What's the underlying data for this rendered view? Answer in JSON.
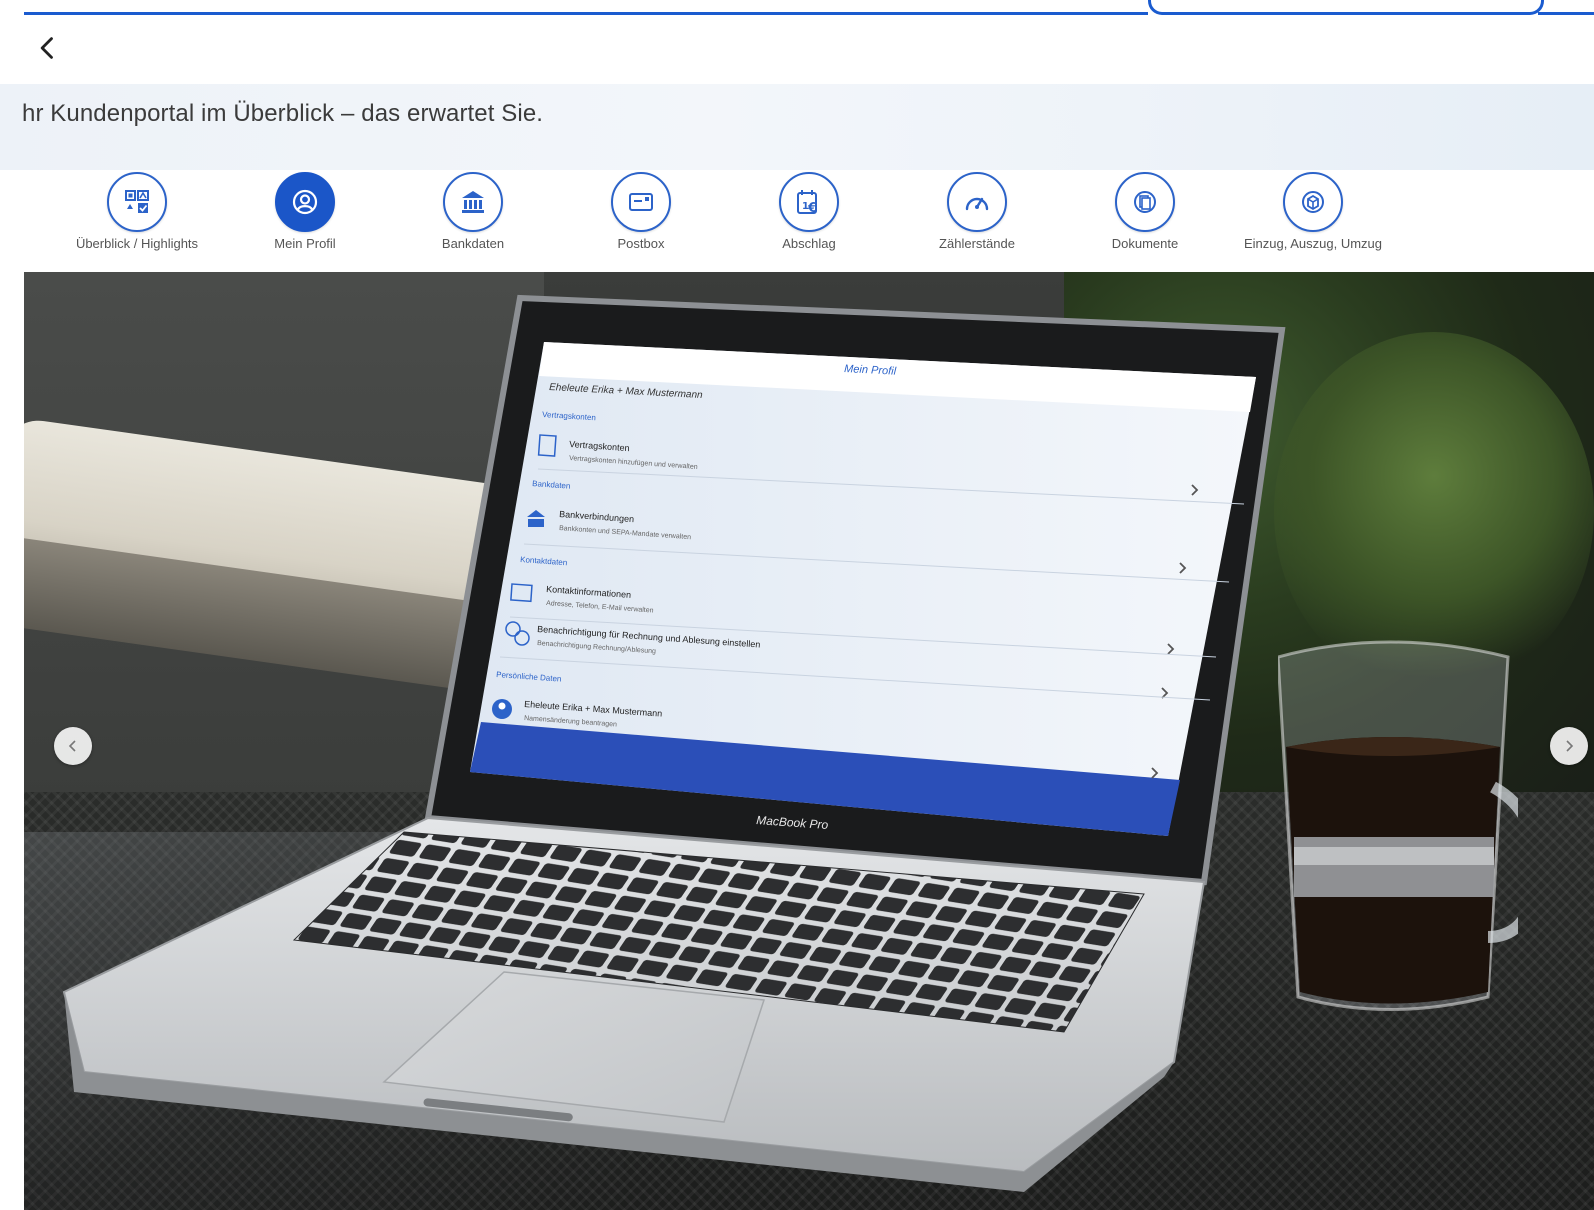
{
  "banner": {
    "title": "hr Kundenportal im Überblick – das erwartet Sie."
  },
  "nav": {
    "items": [
      {
        "label": "Überblick / Highlights",
        "icon": "dashboard-icon",
        "active": false
      },
      {
        "label": "Mein Profil",
        "icon": "user-profile-icon",
        "active": true
      },
      {
        "label": "Bankdaten",
        "icon": "bank-icon",
        "active": false
      },
      {
        "label": "Postbox",
        "icon": "mailbox-icon",
        "active": false
      },
      {
        "label": "Abschlag",
        "icon": "calendar-euro-icon",
        "active": false
      },
      {
        "label": "Zählerstände",
        "icon": "gauge-icon",
        "active": false
      },
      {
        "label": "Dokumente",
        "icon": "documents-icon",
        "active": false
      },
      {
        "label": "Einzug, Auszug, Umzug",
        "icon": "moving-box-icon",
        "active": false
      }
    ]
  },
  "screen": {
    "title": "Mein Profil",
    "account_name": "Eheleute Erika + Max Mustermann",
    "sections": [
      {
        "header": "Vertragskonten",
        "title": "Vertragskonten",
        "subtitle": "Vertragskonten hinzufügen und verwalten",
        "icon": "contract-icon"
      },
      {
        "header": "Bankdaten",
        "title": "Bankverbindungen",
        "subtitle": "Bankkonten und SEPA-Mandate verwalten",
        "icon": "bank-icon"
      },
      {
        "header": "Kontaktdaten",
        "title": "Kontaktinformationen",
        "subtitle": "Adresse, Telefon, E-Mail verwalten",
        "icon": "contact-card-icon"
      },
      {
        "header": "",
        "title": "Benachrichtigung für Rechnung und Ablesung einstellen",
        "subtitle": "Benachrichtigung Rechnung/Ablesung",
        "icon": "chat-bubbles-icon"
      },
      {
        "header": "Persönliche Daten",
        "title": "Eheleute Erika + Max Mustermann",
        "subtitle": "Namensänderung beantragen",
        "icon": "person-icon"
      }
    ]
  },
  "laptop": {
    "brand": "MacBook Pro"
  },
  "colors": {
    "accent": "#1b56c8",
    "topbar": "#1a5bcf",
    "banner_bg": "#eef3f9"
  }
}
